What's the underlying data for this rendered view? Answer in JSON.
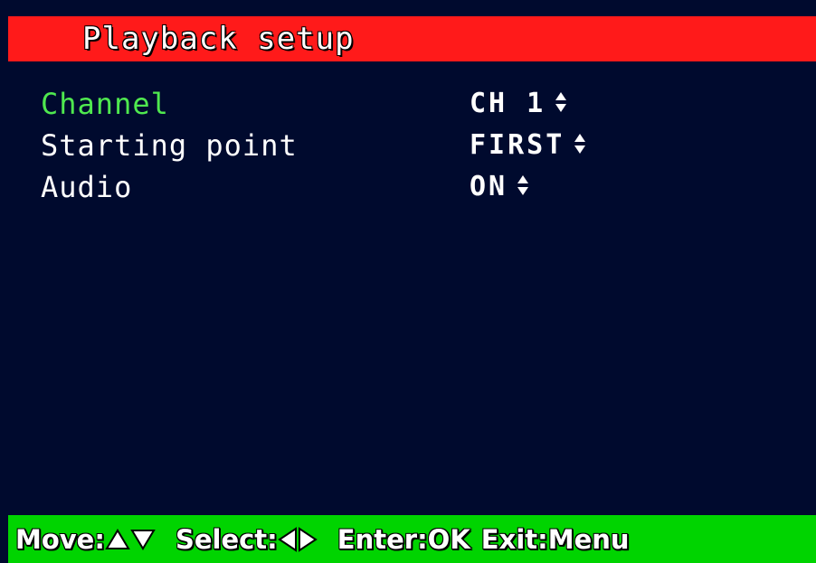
{
  "header": {
    "title": "Playback setup"
  },
  "menu": {
    "items": [
      {
        "label": "Channel",
        "value": "CH 1",
        "active": true
      },
      {
        "label": "Starting point",
        "value": "FIRST",
        "active": false
      },
      {
        "label": "Audio",
        "value": "ON",
        "active": false
      }
    ]
  },
  "footer": {
    "move_label": "Move:",
    "move_icons": [
      "up-triangle-icon",
      "down-triangle-icon"
    ],
    "select_label": "Select:",
    "select_icons": [
      "left-triangle-icon",
      "right-triangle-icon"
    ],
    "enter_label": "Enter:OK",
    "exit_label": "Exit:Menu"
  },
  "colors": {
    "background": "#000a2e",
    "title_bar": "#ff1a1a",
    "footer_bar": "#00d400",
    "active_item": "#4fe84f",
    "text": "#ffffff"
  }
}
